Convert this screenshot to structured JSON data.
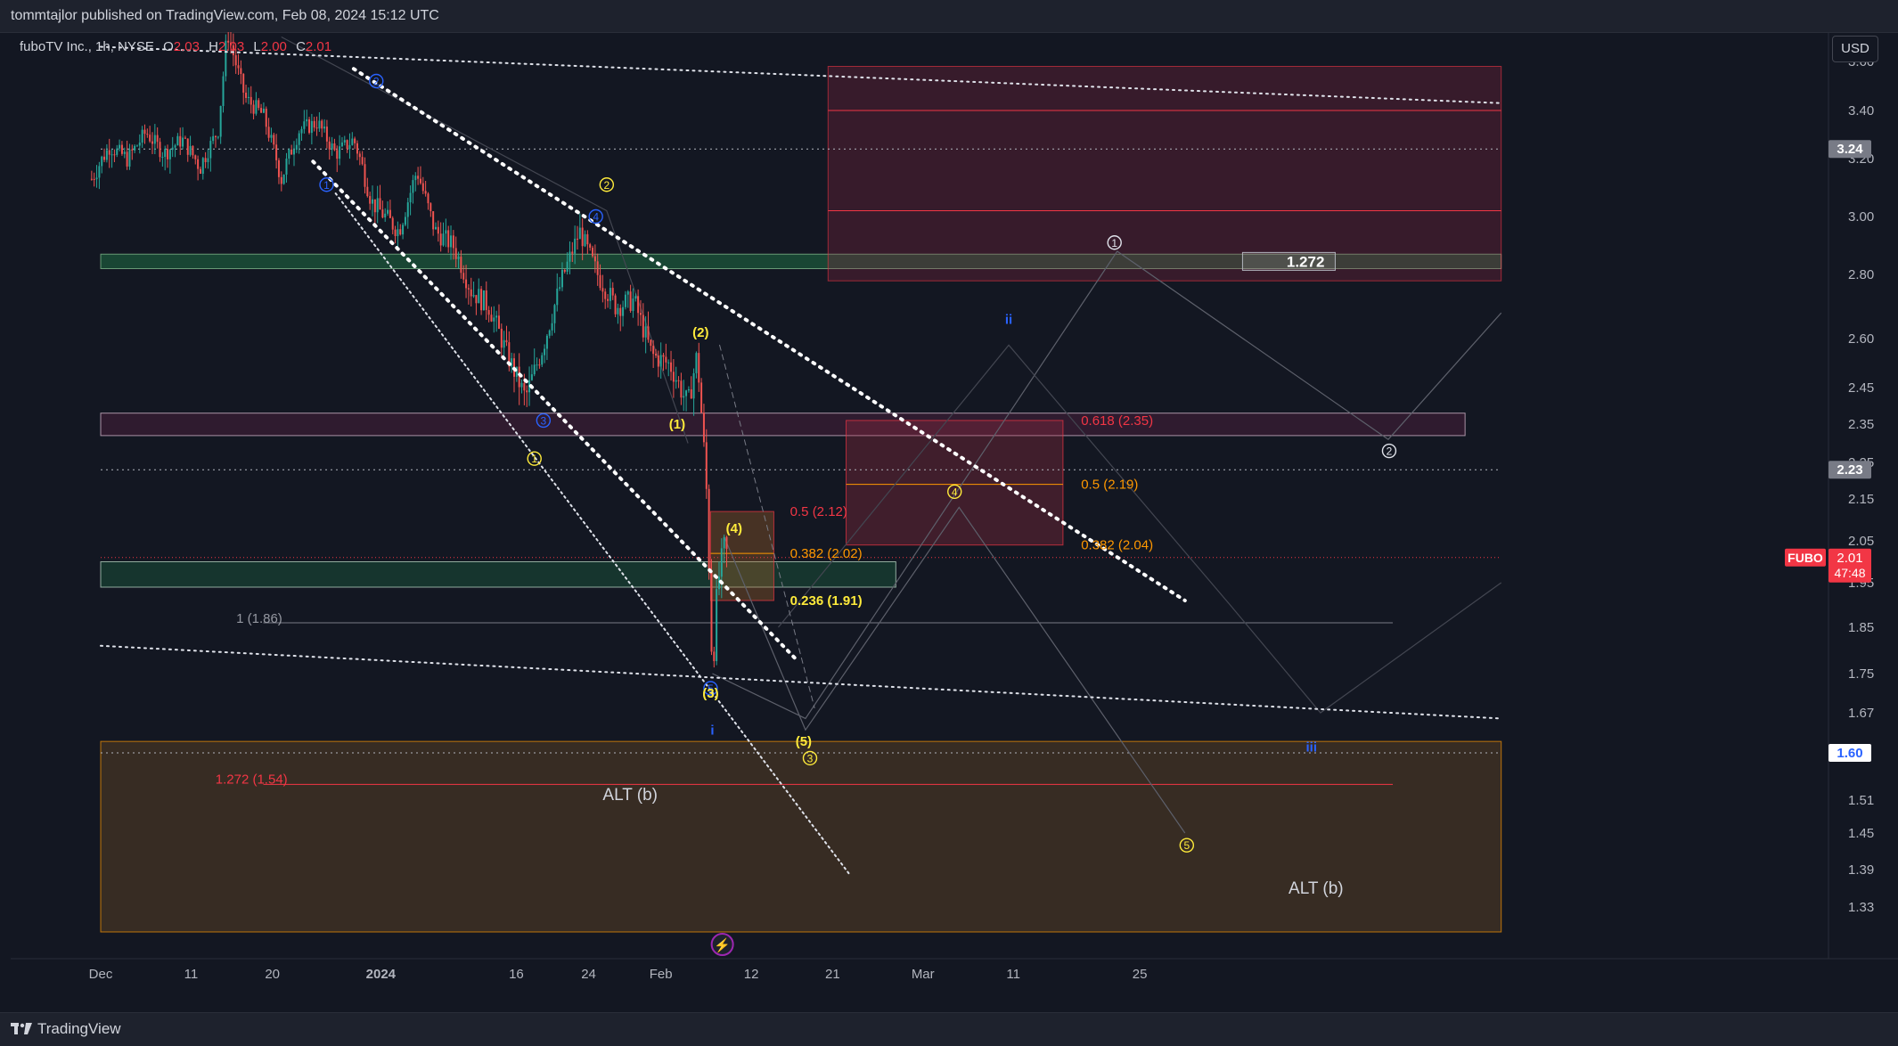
{
  "header": {
    "published": "tommtajlor published on TradingView.com, Feb 08, 2024 15:12 UTC"
  },
  "footer": {
    "brand": "TradingView"
  },
  "toolbar": {
    "currency": "USD"
  },
  "symbol": {
    "name": "fuboTV Inc., 1h, NYSE",
    "o_label": "O",
    "o": "2.03",
    "h_label": "H",
    "h": "2.03",
    "l_label": "L",
    "l": "2.00",
    "c_label": "C",
    "c": "2.01"
  },
  "colors": {
    "background": "#131722",
    "up": "#26a69a",
    "down": "#ef5350",
    "fib_red": "#f23645",
    "fib_orange": "#ff9800",
    "wave_yellow": "#ffeb3b",
    "wave_blue": "#2962ff"
  },
  "chart_data": {
    "type": "candlestick",
    "x_ticks": [
      {
        "label": "Dec",
        "day": 0
      },
      {
        "label": "11",
        "day": 10
      },
      {
        "label": "20",
        "day": 19
      },
      {
        "label": "2024",
        "day": 31
      },
      {
        "label": "16",
        "day": 46
      },
      {
        "label": "24",
        "day": 54
      },
      {
        "label": "Feb",
        "day": 62
      },
      {
        "label": "12",
        "day": 72
      },
      {
        "label": "21",
        "day": 81
      },
      {
        "label": "Mar",
        "day": 91
      },
      {
        "label": "11",
        "day": 101
      },
      {
        "label": "25",
        "day": 115
      }
    ],
    "y_ticks": [
      "3.60",
      "3.40",
      "3.20",
      "3.00",
      "2.80",
      "2.60",
      "2.45",
      "2.35",
      "2.25",
      "2.15",
      "2.05",
      "1.95",
      "1.85",
      "1.75",
      "1.67",
      "1.51",
      "1.45",
      "1.39",
      "1.33"
    ],
    "price_badges": [
      {
        "price": 3.24,
        "label": "3.24",
        "bg": "#787b86",
        "fg": "#ffffff"
      },
      {
        "price": 2.23,
        "label": "2.23",
        "bg": "#787b86",
        "fg": "#ffffff"
      },
      {
        "price": 1.6,
        "label": "1.60",
        "bg": "#ffffff",
        "fg": "#2962ff"
      }
    ],
    "last_price": {
      "price": 2.01,
      "symbol": "FUBO",
      "value": "2.01",
      "countdown": "47:48",
      "color": "#f23645"
    },
    "price_path": [
      {
        "day": -1,
        "p": 3.13
      },
      {
        "day": 1,
        "p": 3.25
      },
      {
        "day": 3,
        "p": 3.2
      },
      {
        "day": 5,
        "p": 3.31
      },
      {
        "day": 7,
        "p": 3.22
      },
      {
        "day": 9,
        "p": 3.28
      },
      {
        "day": 11,
        "p": 3.17
      },
      {
        "day": 13,
        "p": 3.32
      },
      {
        "day": 14,
        "p": 3.72
      },
      {
        "day": 16,
        "p": 3.45
      },
      {
        "day": 18,
        "p": 3.38
      },
      {
        "day": 20,
        "p": 3.13
      },
      {
        "day": 22,
        "p": 3.32
      },
      {
        "day": 24,
        "p": 3.35
      },
      {
        "day": 26,
        "p": 3.22
      },
      {
        "day": 28,
        "p": 3.28
      },
      {
        "day": 30,
        "p": 3.05
      },
      {
        "day": 33,
        "p": 2.95
      },
      {
        "day": 35,
        "p": 3.16
      },
      {
        "day": 37,
        "p": 2.95
      },
      {
        "day": 39,
        "p": 2.9
      },
      {
        "day": 41,
        "p": 2.75
      },
      {
        "day": 43,
        "p": 2.7
      },
      {
        "day": 45,
        "p": 2.55
      },
      {
        "day": 47,
        "p": 2.42
      },
      {
        "day": 49,
        "p": 2.58
      },
      {
        "day": 51,
        "p": 2.78
      },
      {
        "day": 53,
        "p": 2.95
      },
      {
        "day": 55,
        "p": 2.8
      },
      {
        "day": 57,
        "p": 2.7
      },
      {
        "day": 59,
        "p": 2.72
      },
      {
        "day": 61,
        "p": 2.55
      },
      {
        "day": 63,
        "p": 2.52
      },
      {
        "day": 65,
        "p": 2.4
      },
      {
        "day": 66,
        "p": 2.55
      },
      {
        "day": 67,
        "p": 2.2
      },
      {
        "day": 67.7,
        "p": 1.75
      },
      {
        "day": 68.3,
        "p": 1.95
      },
      {
        "day": 69,
        "p": 2.03
      },
      {
        "day": 69.5,
        "p": 2.01
      }
    ],
    "zones": [
      {
        "from_day": 0,
        "to_day": 155,
        "top": 2.87,
        "bottom": 2.82,
        "fill": "rgba(38,166,91,0.33)",
        "stroke": "rgba(140,200,150,0.7)"
      },
      {
        "from_day": 0,
        "to_day": 151,
        "top": 2.38,
        "bottom": 2.32,
        "fill": "rgba(180,50,110,0.18)",
        "stroke": "rgba(230,200,220,0.7)"
      },
      {
        "from_day": 0,
        "to_day": 88,
        "top": 2.0,
        "bottom": 1.94,
        "fill": "rgba(38,166,91,0.22)",
        "stroke": "rgba(200,230,210,0.7)"
      },
      {
        "from_day": 80.5,
        "to_day": 155,
        "top": 3.58,
        "bottom": 2.78,
        "fill": "rgba(150,40,70,0.28)",
        "stroke": "rgba(242,54,69,0.6)"
      },
      {
        "from_day": 82.5,
        "to_day": 106.5,
        "top": 2.36,
        "bottom": 2.04,
        "fill": "rgba(170,45,70,0.30)",
        "stroke": "rgba(242,54,69,0.7)"
      },
      {
        "from_day": 0,
        "to_day": 155,
        "top": 1.62,
        "bottom": 1.29,
        "fill": "rgba(150,100,40,0.28)",
        "stroke": "rgba(255,152,0,0.7)"
      },
      {
        "from_day": 67.5,
        "to_day": 74.5,
        "top": 2.12,
        "bottom": 1.91,
        "fill": "rgba(170,100,40,0.35)",
        "stroke": "rgba(242,54,69,0.7)"
      }
    ],
    "h_lines": [
      {
        "price": 3.4,
        "from_day": 80.5,
        "to_day": 155,
        "color": "#f23645",
        "width": 1
      },
      {
        "price": 3.02,
        "from_day": 80.5,
        "to_day": 155,
        "color": "#f23645",
        "width": 1
      },
      {
        "price": 2.19,
        "from_day": 82.5,
        "to_day": 106.5,
        "color": "#ff9800",
        "width": 1
      },
      {
        "price": 2.02,
        "from_day": 67.5,
        "to_day": 74.5,
        "color": "#ff9800",
        "width": 1
      },
      {
        "price": 1.86,
        "from_day": 18,
        "to_day": 143,
        "color": "#787b86",
        "width": 1
      },
      {
        "price": 1.54,
        "from_day": 18,
        "to_day": 143,
        "color": "#f23645",
        "width": 1
      },
      {
        "price": 3.24,
        "from_day": 0,
        "to_day": 155,
        "color": "#b2b5be",
        "width": 1,
        "dash": "2 4"
      },
      {
        "price": 2.23,
        "from_day": 0,
        "to_day": 155,
        "color": "#b2b5be",
        "width": 1,
        "dash": "2 4"
      },
      {
        "price": 1.6,
        "from_day": 0,
        "to_day": 155,
        "color": "#b2b5be",
        "width": 1,
        "dash": "2 4"
      },
      {
        "price": 2.01,
        "from_day": 0,
        "to_day": 155,
        "color": "#f23645",
        "width": 1,
        "dash": "1 3"
      }
    ],
    "trend_lines": [
      {
        "p1": [
          0,
          3.66
        ],
        "p2": [
          155,
          3.43
        ],
        "color": "#e0e3eb",
        "width": 2,
        "dash": "2 5"
      },
      {
        "p1": [
          0,
          1.81
        ],
        "p2": [
          155,
          1.66
        ],
        "color": "#e0e3eb",
        "width": 2,
        "dash": "2 5"
      },
      {
        "p1": [
          28,
          3.57
        ],
        "p2": [
          120,
          1.91
        ],
        "color": "#ffffff",
        "width": 4,
        "dash": "2 7"
      },
      {
        "p1": [
          23.5,
          3.19
        ],
        "p2": [
          77,
          1.78
        ],
        "color": "#ffffff",
        "width": 4,
        "dash": "2 7"
      },
      {
        "p1": [
          26,
          3.08
        ],
        "p2": [
          83,
          1.38
        ],
        "color": "#e0e3eb",
        "width": 2,
        "dash": "2 4"
      },
      {
        "p1": [
          68.5,
          2.58
        ],
        "p2": [
          79,
          1.68
        ],
        "color": "#787b86",
        "width": 1,
        "dash": "6 5"
      }
    ],
    "poly_lines": [
      {
        "pts": [
          [
            67.7,
            1.75
          ],
          [
            78,
            1.66
          ],
          [
            112.5,
            2.88
          ],
          [
            142.5,
            2.31
          ],
          [
            155,
            2.68
          ]
        ],
        "color": "#5d606b"
      },
      {
        "pts": [
          [
            69,
            2.06
          ],
          [
            78,
            1.64
          ],
          [
            95,
            2.13
          ],
          [
            120,
            1.45
          ]
        ],
        "color": "#5d606b"
      },
      {
        "pts": [
          [
            75,
            1.85
          ],
          [
            100.5,
            2.58
          ],
          [
            125,
            1.9
          ],
          [
            135,
            1.67
          ],
          [
            155,
            1.95
          ]
        ],
        "color": "#434651"
      },
      {
        "pts": [
          [
            20,
            3.7
          ],
          [
            56,
            3.02
          ],
          [
            65,
            2.3
          ]
        ],
        "color": "#434651"
      }
    ],
    "fib_labels": [
      {
        "text": "0.618 (2.35)",
        "day": 108.5,
        "price": 2.36,
        "color": "#f23645"
      },
      {
        "text": "0.5 (2.19)",
        "day": 108.5,
        "price": 2.19,
        "color": "#ff9800"
      },
      {
        "text": "0.382 (2.04)",
        "day": 108.5,
        "price": 2.04,
        "color": "#ff9800"
      },
      {
        "text": "0.5 (2.12)",
        "day": 76.3,
        "price": 2.12,
        "color": "#f23645"
      },
      {
        "text": "0.382 (2.02)",
        "day": 76.3,
        "price": 2.02,
        "color": "#ff9800"
      },
      {
        "text": "0.236 (1.91)",
        "day": 76.3,
        "price": 1.91,
        "color": "#ffeb3b",
        "bold": true
      },
      {
        "text": "1 (1.86)",
        "day": 15,
        "price": 1.87,
        "color": "#9598a1"
      },
      {
        "text": "1.272 (1.54)",
        "day": 12.7,
        "price": 1.55,
        "color": "#f23645"
      }
    ],
    "wave_labels": [
      {
        "text": "1",
        "day": 25,
        "price": 3.11,
        "color": "#2962ff",
        "circle": true
      },
      {
        "text": "2",
        "day": 30.5,
        "price": 3.52,
        "color": "#2962ff",
        "circle": true
      },
      {
        "text": "3",
        "day": 49,
        "price": 2.36,
        "color": "#2962ff",
        "circle": true
      },
      {
        "text": "4",
        "day": 54.8,
        "price": 3.0,
        "color": "#2962ff",
        "circle": true
      },
      {
        "text": "5",
        "day": 67.5,
        "price": 1.72,
        "color": "#2962ff",
        "circle": true
      },
      {
        "text": "C",
        "day": 21,
        "price": 3.81,
        "color": "#2962ff"
      },
      {
        "text": "i",
        "day": 67.7,
        "price": 1.64,
        "color": "#2962ff"
      },
      {
        "text": "ii",
        "day": 100.5,
        "price": 2.66,
        "color": "#2962ff"
      },
      {
        "text": "iii",
        "day": 134,
        "price": 1.61,
        "color": "#2962ff"
      },
      {
        "text": "1",
        "day": 48,
        "price": 2.26,
        "color": "#ffeb3b",
        "circle": true
      },
      {
        "text": "2",
        "day": 56,
        "price": 3.11,
        "color": "#ffeb3b",
        "circle": true
      },
      {
        "text": "3",
        "day": 78.5,
        "price": 1.59,
        "color": "#ffeb3b",
        "circle": true
      },
      {
        "text": "4",
        "day": 94.5,
        "price": 2.17,
        "color": "#ffeb3b",
        "circle": true
      },
      {
        "text": "5",
        "day": 120.2,
        "price": 1.43,
        "color": "#ffeb3b",
        "circle": true
      },
      {
        "text": "(1)",
        "day": 63.8,
        "price": 2.35,
        "color": "#ffeb3b"
      },
      {
        "text": "(2)",
        "day": 66.4,
        "price": 2.62,
        "color": "#ffeb3b"
      },
      {
        "text": "(3)",
        "day": 67.5,
        "price": 1.71,
        "color": "#ffeb3b"
      },
      {
        "text": "(4)",
        "day": 70.1,
        "price": 2.08,
        "color": "#ffeb3b"
      },
      {
        "text": "(5)",
        "day": 77.8,
        "price": 1.62,
        "color": "#ffeb3b"
      },
      {
        "text": "1",
        "day": 112.2,
        "price": 2.91,
        "color": "#e0e3eb",
        "circle": true
      },
      {
        "text": "2",
        "day": 142.6,
        "price": 2.28,
        "color": "#e0e3eb",
        "circle": true
      }
    ],
    "text_labels": [
      {
        "text": "ALT (b)",
        "day": 58.6,
        "price": 1.52,
        "color": "#d1d4dc",
        "size": 19
      },
      {
        "text": "ALT (b)",
        "day": 134.5,
        "price": 1.36,
        "color": "#d1d4dc",
        "size": 19
      }
    ],
    "ratio_box": {
      "text": "1.272",
      "day": 131.5,
      "price": 2.845
    },
    "event": {
      "day": 68.8,
      "glyph": "⚡"
    }
  }
}
